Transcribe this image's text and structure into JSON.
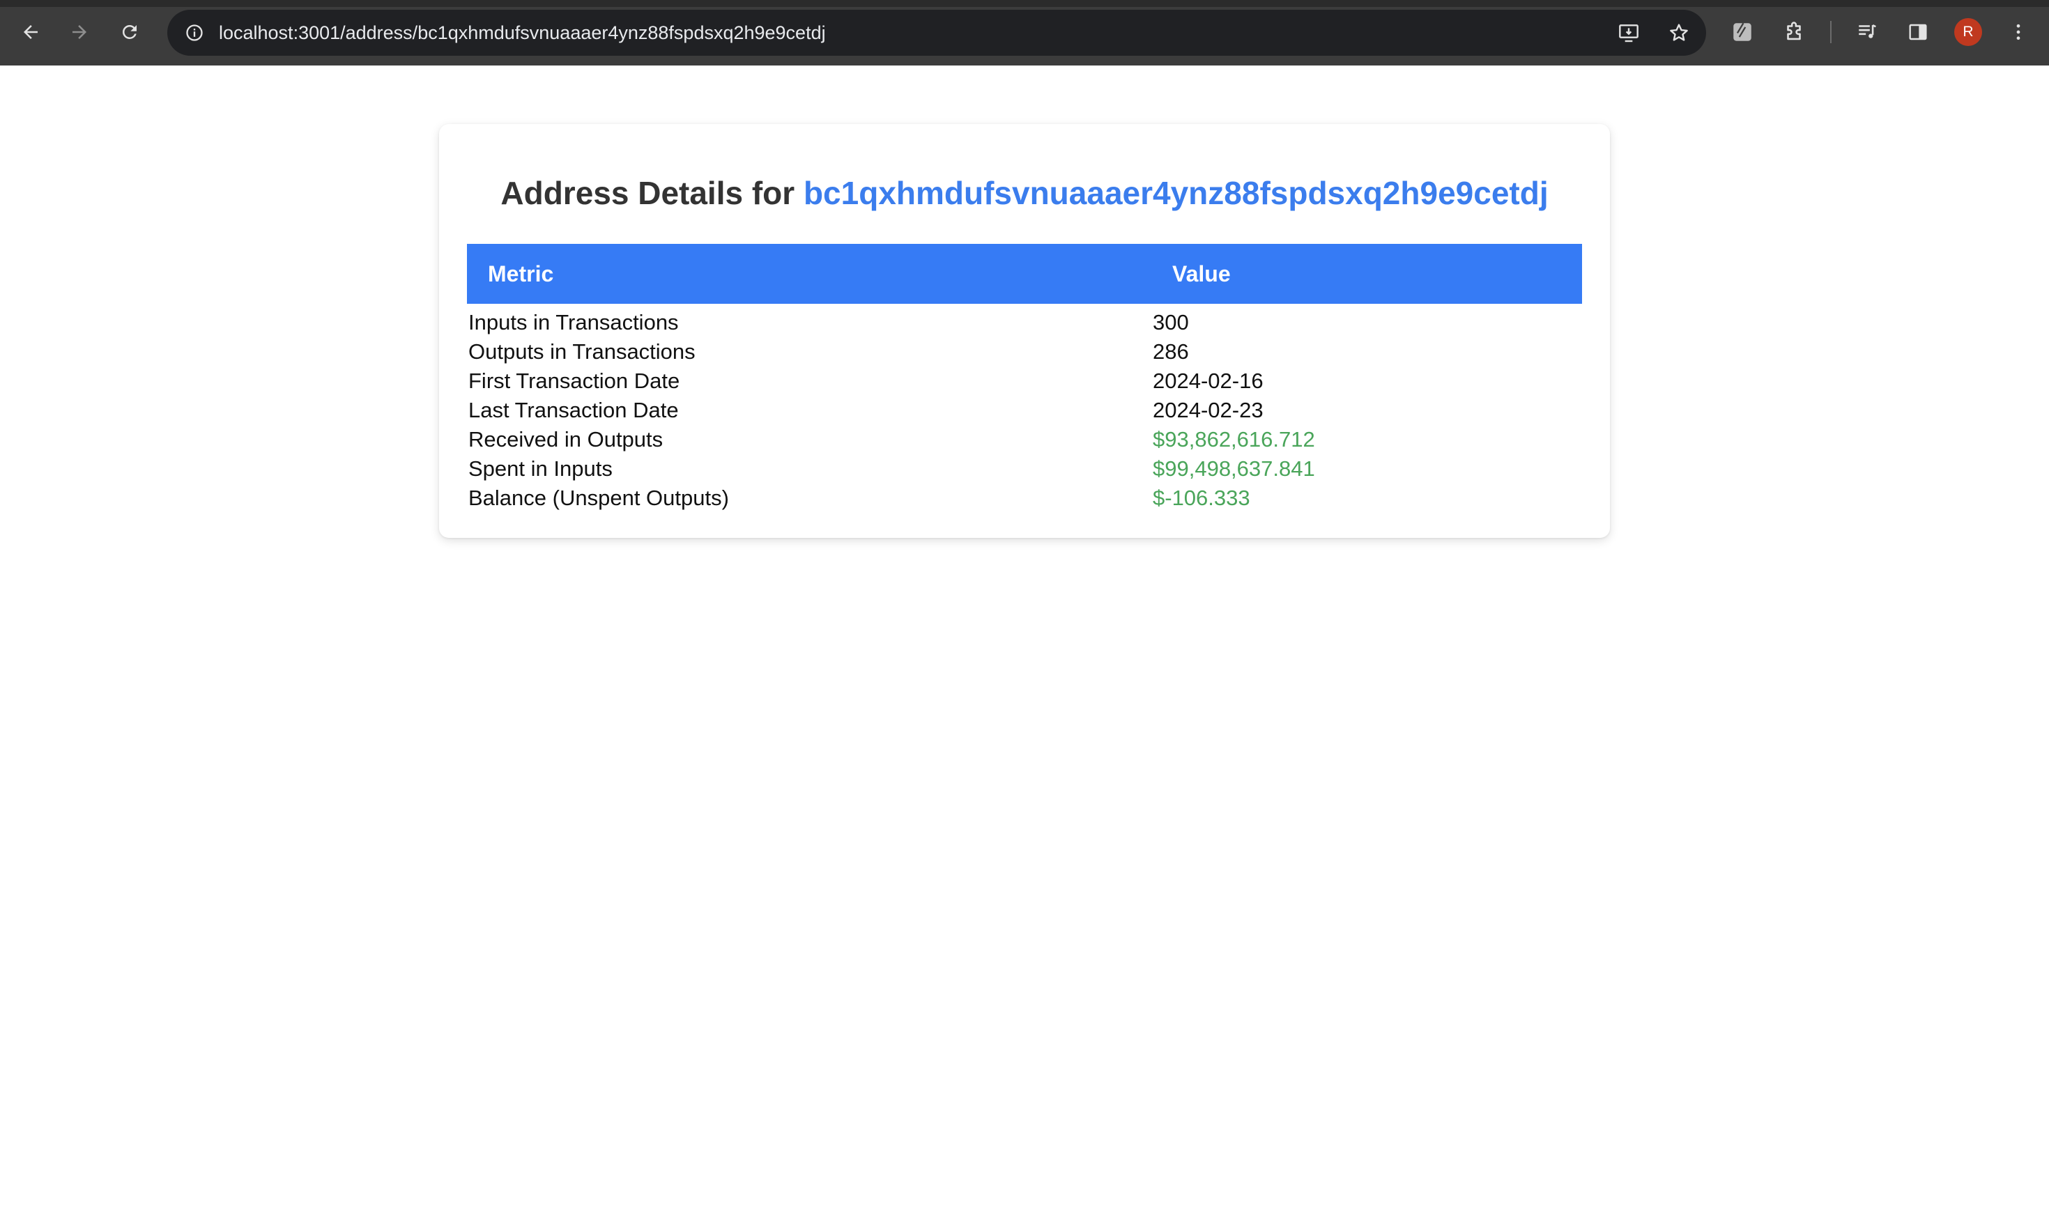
{
  "browser": {
    "url": "localhost:3001/address/bc1qxhmdufsvnuaaaer4ynz88fspdsxq2h9e9cetdj",
    "avatar_initial": "R",
    "icons": {
      "back": "arrow-left-icon",
      "forward": "arrow-right-icon",
      "reload": "reload-icon",
      "site_info": "info-icon",
      "install": "install-app-icon",
      "bookmark": "star-icon",
      "extension": "extension-icon",
      "extensions_menu": "puzzle-icon",
      "media": "media-controls-icon",
      "side_panel": "side-panel-icon",
      "menu": "kebab-menu-icon"
    }
  },
  "page": {
    "title_prefix": "Address Details for",
    "address": "bc1qxhmdufsvnuaaaer4ynz88fspdsxq2h9e9cetdj",
    "table": {
      "headers": {
        "metric": "Metric",
        "value": "Value"
      },
      "rows": [
        {
          "metric": "Inputs in Transactions",
          "value": "300"
        },
        {
          "metric": "Outputs in Transactions",
          "value": "286"
        },
        {
          "metric": "First Transaction Date",
          "value": "2024-02-16"
        },
        {
          "metric": "Last Transaction Date",
          "value": "2024-02-23"
        },
        {
          "metric": "Received in Outputs",
          "value": "$93,862,616.712"
        },
        {
          "metric": "Spent in Inputs",
          "value": "$99,498,637.841"
        },
        {
          "metric": "Balance (Unspent Outputs)",
          "value": "$-106.333"
        }
      ]
    },
    "colors": {
      "header_bg": "#367bf5",
      "address_link": "#3b7ded",
      "money_value": "#4aa55a"
    }
  }
}
